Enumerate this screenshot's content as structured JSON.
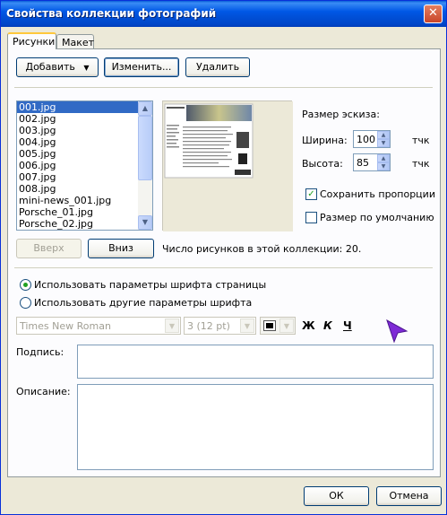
{
  "window": {
    "title": "Свойства коллекции фотографий",
    "close_glyph": "✕"
  },
  "tabs": [
    {
      "label": "Рисунки"
    },
    {
      "label": "Макет"
    }
  ],
  "toolbar": {
    "add_label": "Добавить",
    "add_arrow": "▼",
    "edit_label": "Изменить...",
    "delete_label": "Удалить"
  },
  "files": [
    "001.jpg",
    "002.jpg",
    "003.jpg",
    "004.jpg",
    "005.jpg",
    "006.jpg",
    "007.jpg",
    "008.jpg",
    "mini-news_001.jpg",
    "Porsche_01.jpg",
    "Porsche_02.jpg"
  ],
  "selected_file": "001.jpg",
  "thumbnail": {
    "heading": "Размер эскиза:",
    "width_label": "Ширина:",
    "width_value": "100",
    "width_unit": "тчк",
    "height_label": "Высота:",
    "height_value": "85",
    "height_unit": "тчк",
    "keep_ratio_label": "Сохранить пропорции",
    "keep_ratio_checked": true,
    "default_size_label": "Размер по умолчанию",
    "default_size_checked": false
  },
  "order": {
    "up_label": "Вверх",
    "down_label": "Вниз",
    "count_text": "Число рисунков в этой коллекции: 20."
  },
  "font_options": {
    "use_page_label": "Использовать параметры шрифта страницы",
    "use_other_label": "Использовать другие параметры шрифта",
    "selected": "use_page"
  },
  "font_toolbar": {
    "font_name": "Times New Roman",
    "font_size": "3  (12 pt)",
    "bold": "Ж",
    "italic": "К",
    "underline": "Ч"
  },
  "fields": {
    "caption_label": "Подпись:",
    "description_label": "Описание:"
  },
  "footer": {
    "ok_label": "ОК",
    "cancel_label": "Отмена"
  },
  "colors": {
    "accent": "#316ac5",
    "title_bar": "#0058e6",
    "background": "#ece9d8"
  }
}
